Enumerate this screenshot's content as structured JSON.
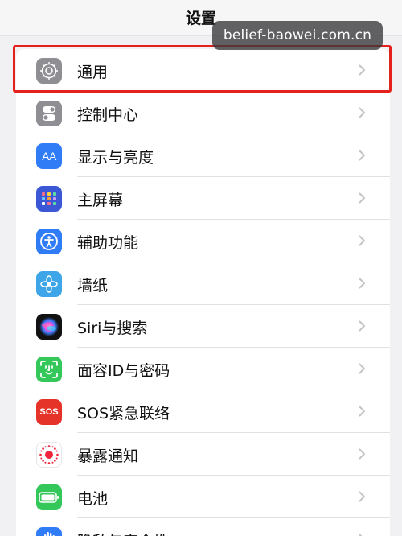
{
  "header": {
    "title": "设置"
  },
  "watermark": {
    "text": "belief-baowei.com.cn"
  },
  "settings": {
    "items": [
      {
        "label": "通用",
        "icon": "gear-icon",
        "color": "#8e8e93",
        "highlighted": true
      },
      {
        "label": "控制中心",
        "icon": "toggles-icon",
        "color": "#8e8e93"
      },
      {
        "label": "显示与亮度",
        "icon": "text-size-icon",
        "color": "#2f7cf6"
      },
      {
        "label": "主屏幕",
        "icon": "app-grid-icon",
        "color": "#3a58d6"
      },
      {
        "label": "辅助功能",
        "icon": "accessibility-icon",
        "color": "#2f7cf6"
      },
      {
        "label": "墙纸",
        "icon": "flower-icon",
        "color": "#3ea6e8"
      },
      {
        "label": "Siri与搜索",
        "icon": "siri-icon",
        "color": "#1a1a2e"
      },
      {
        "label": "面容ID与密码",
        "icon": "face-id-icon",
        "color": "#34c759"
      },
      {
        "label": "SOS紧急联络",
        "icon": "sos-icon",
        "color": "#e5332a",
        "icon_text": "SOS"
      },
      {
        "label": "暴露通知",
        "icon": "exposure-icon",
        "color": "#ffffff"
      },
      {
        "label": "电池",
        "icon": "battery-icon",
        "color": "#34c759"
      },
      {
        "label": "隐私与安全性",
        "icon": "privacy-hand-icon",
        "color": "#2f7cf6"
      }
    ]
  },
  "colors": {
    "background": "#f1f1f4",
    "highlight_border": "#e5211c",
    "chevron": "#c4c4c7"
  }
}
